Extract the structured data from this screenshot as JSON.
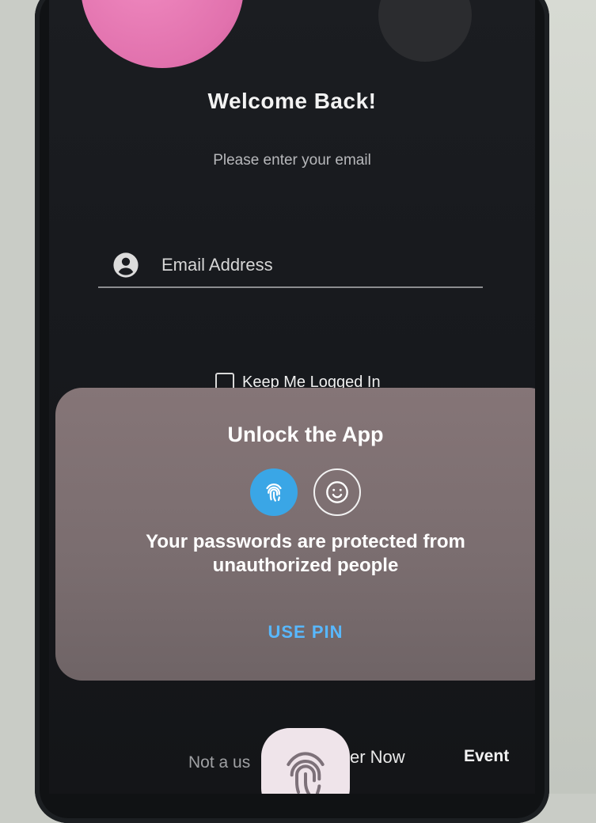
{
  "screen": {
    "title": "Welcome Back!",
    "subtitle": "Please enter your email"
  },
  "email": {
    "placeholder": "Email Address",
    "value": "",
    "icon": "account-circle-icon"
  },
  "keep_logged_in": {
    "label": "Keep Me Logged In",
    "checked": false
  },
  "biometric_sheet": {
    "title": "Unlock the App",
    "options": [
      {
        "name": "fingerprint",
        "icon": "fingerprint-icon",
        "selected": true
      },
      {
        "name": "face",
        "icon": "face-icon",
        "selected": false
      }
    ],
    "message": "Your passwords are protected from unauthorized people",
    "use_pin_label": "USE PIN"
  },
  "bottom": {
    "left_text": "Not a us",
    "middle_text": "er Now",
    "right_text": "Event"
  },
  "colors": {
    "accent_blue": "#3aa6e6",
    "pin_blue": "#58b8ff",
    "sheet_bg": "#7a6d6f",
    "screen_bg": "#17191d",
    "decor_pink": "#e171ad"
  }
}
